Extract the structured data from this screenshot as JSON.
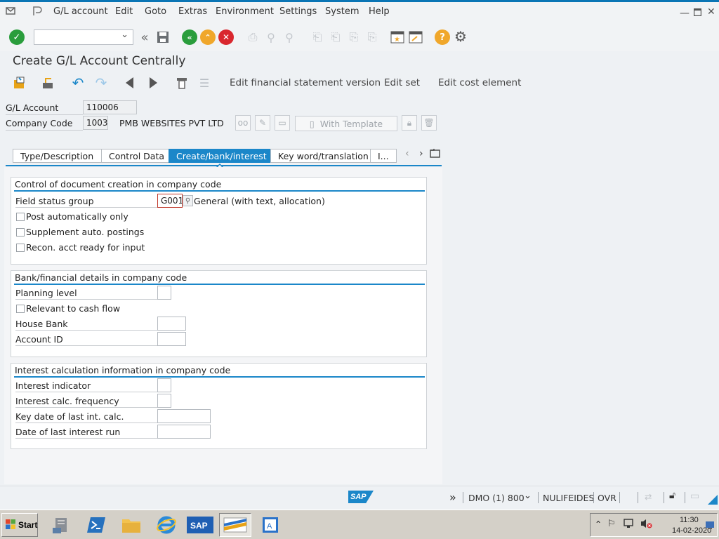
{
  "menubar": {
    "items": [
      "G/L account",
      "Edit",
      "Goto",
      "Extras",
      "Environment",
      "Settings",
      "System",
      "Help"
    ]
  },
  "toolbar": {
    "command_field": ""
  },
  "page": {
    "title": "Create G/L Account Centrally"
  },
  "app_toolbar": {
    "edit_fs_version": "Edit financial statement version",
    "edit_set": "Edit set",
    "edit_cost_element": "Edit cost element"
  },
  "header": {
    "gl_account_label": "G/L Account",
    "gl_account_value": "110006",
    "company_code_label": "Company Code",
    "company_code_value": "1003",
    "company_name": "PMB WEBSITES PVT LTD",
    "with_template_label": "With Template"
  },
  "tabs": [
    {
      "label": "Type/Description",
      "active": false
    },
    {
      "label": "Control Data",
      "active": false
    },
    {
      "label": "Create/bank/interest",
      "active": true
    },
    {
      "label": "Key word/translation",
      "active": false
    },
    {
      "label": "I...",
      "active": false
    }
  ],
  "doc_creation": {
    "title": "Control of document creation in company code",
    "field_status_group_label": "Field status group",
    "field_status_group_value": "G001",
    "field_status_group_desc": "General (with text, allocation)",
    "post_auto_label": "Post automatically only",
    "post_auto_checked": false,
    "supplement_label": "Supplement auto. postings",
    "supplement_checked": false,
    "recon_label": "Recon. acct ready for input",
    "recon_checked": false
  },
  "bank_details": {
    "title": "Bank/financial details in company code",
    "planning_level_label": "Planning level",
    "planning_level_value": "",
    "cash_flow_label": "Relevant to cash flow",
    "cash_flow_checked": false,
    "house_bank_label": "House Bank",
    "house_bank_value": "",
    "account_id_label": "Account ID",
    "account_id_value": ""
  },
  "interest": {
    "title": "Interest calculation information in company code",
    "indicator_label": "Interest indicator",
    "indicator_value": "",
    "frequency_label": "Interest calc. frequency",
    "frequency_value": "",
    "key_date_label": "Key date of last int. calc.",
    "key_date_value": "",
    "last_run_label": "Date of last interest run",
    "last_run_value": ""
  },
  "statusbar": {
    "system": "DMO (1) 800",
    "user": "NULIFEIDES",
    "mode": "OVR",
    "logo": "SAP"
  },
  "taskbar": {
    "start_label": "Start",
    "time": "11:30",
    "date": "14-02-2020"
  },
  "colors": {
    "accent": "#1b87c9",
    "enter_green": "#2a9d3c",
    "nav_green": "#2a9d3c",
    "exit_orange": "#f0a72b",
    "cancel_red": "#d9272e",
    "help_yellow": "#f0a72b"
  },
  "icons": [
    "enter-icon",
    "save-icon",
    "back-icon",
    "exit-icon",
    "cancel-icon",
    "print-icon",
    "find-icon",
    "help-icon",
    "settings-icon",
    "create-session-icon",
    "shortcut-icon"
  ]
}
